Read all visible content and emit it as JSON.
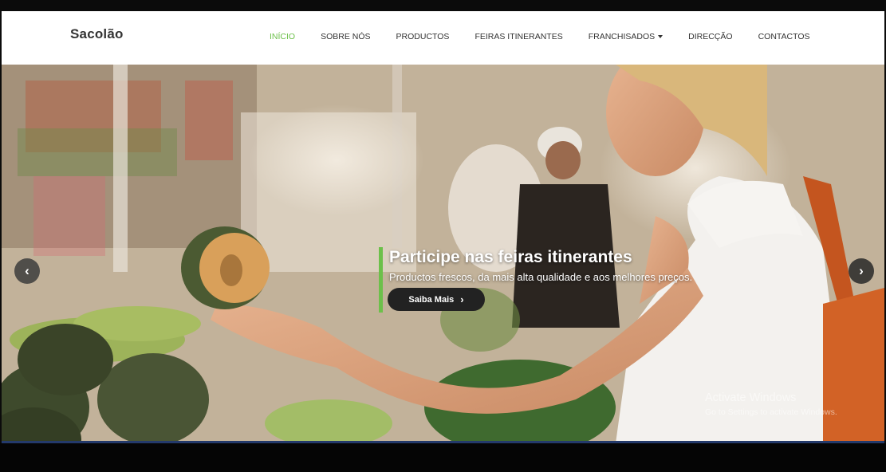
{
  "brand": "Sacolão",
  "nav": {
    "items": [
      {
        "label": "INÍCIO",
        "active": true
      },
      {
        "label": "SOBRE NÓS"
      },
      {
        "label": "PRODUCTOS"
      },
      {
        "label": "FEIRAS ITINERANTES"
      },
      {
        "label": "FRANCHISADOS",
        "dropdown": true
      },
      {
        "label": "DIRECÇÃO"
      },
      {
        "label": "CONTACTOS"
      }
    ],
    "active_color": "#6cc04a"
  },
  "hero": {
    "title": "Participe nas feiras itinerantes",
    "subtitle": "Productos frescos, da mais alta qualidade e aos melhores preços.",
    "button_label": "Saiba Mais",
    "accent_color": "#6cc04a",
    "prev_icon": "chevron-left-icon",
    "next_icon": "chevron-right-icon"
  },
  "watermark": {
    "title": "Activate Windows",
    "subtitle": "Go to Settings to activate Windows."
  }
}
